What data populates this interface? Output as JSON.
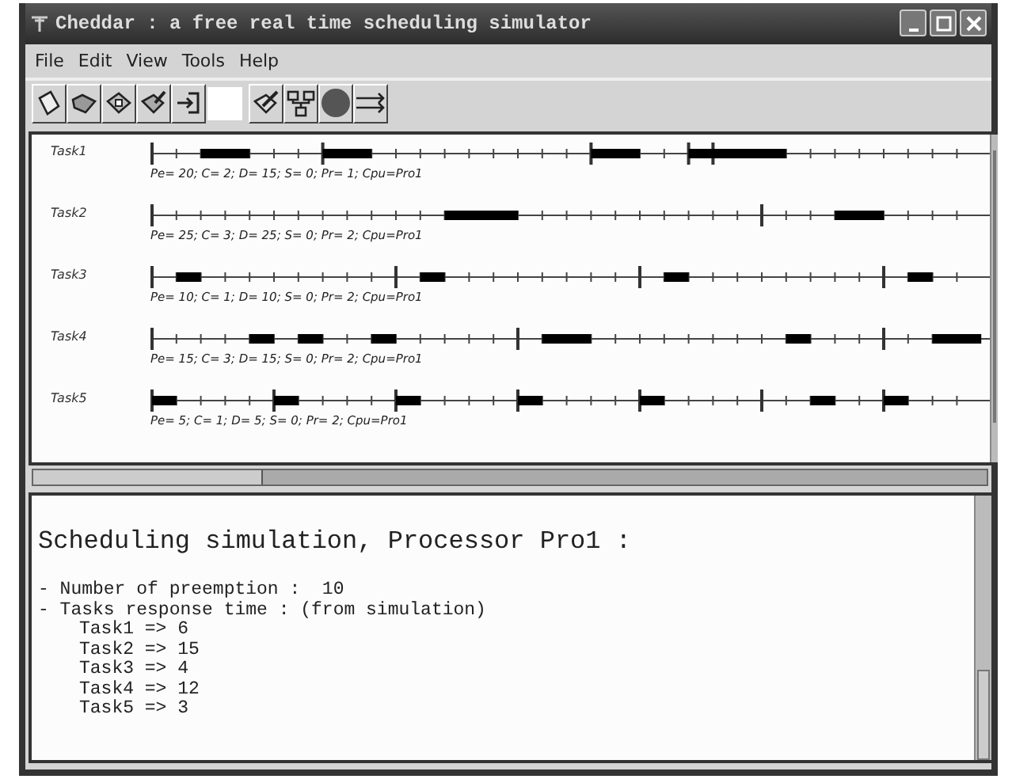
{
  "window": {
    "title": "Cheddar : a free real time scheduling simulator"
  },
  "menu": [
    "File",
    "Edit",
    "View",
    "Tools",
    "Help"
  ],
  "gantt": {
    "tasks": [
      {
        "name": "Task1",
        "params": "Pe= 20; C= 2; D= 15; S= 0; Pr= 1; Cpu=Pro1"
      },
      {
        "name": "Task2",
        "params": "Pe= 25; C= 3; D= 25; S= 0; Pr= 2; Cpu=Pro1"
      },
      {
        "name": "Task3",
        "params": "Pe= 10; C= 1; D= 10; S= 0; Pr= 2; Cpu=Pro1"
      },
      {
        "name": "Task4",
        "params": "Pe= 15; C= 3; D= 15; S= 0; Pr= 2; Cpu=Pro1"
      },
      {
        "name": "Task5",
        "params": "Pe= 5; C= 1; D= 5; S= 0; Pr= 2; Cpu=Pro1"
      }
    ]
  },
  "output": {
    "heading": "Scheduling simulation, Processor Pro1 :",
    "lines": [
      "- Number of preemption :  10",
      "- Tasks response time : (from simulation)"
    ],
    "response_times": [
      "Task1 => 6",
      "Task2 => 15",
      "Task3 => 4",
      "Task4 => 12",
      "Task5 => 3"
    ]
  }
}
